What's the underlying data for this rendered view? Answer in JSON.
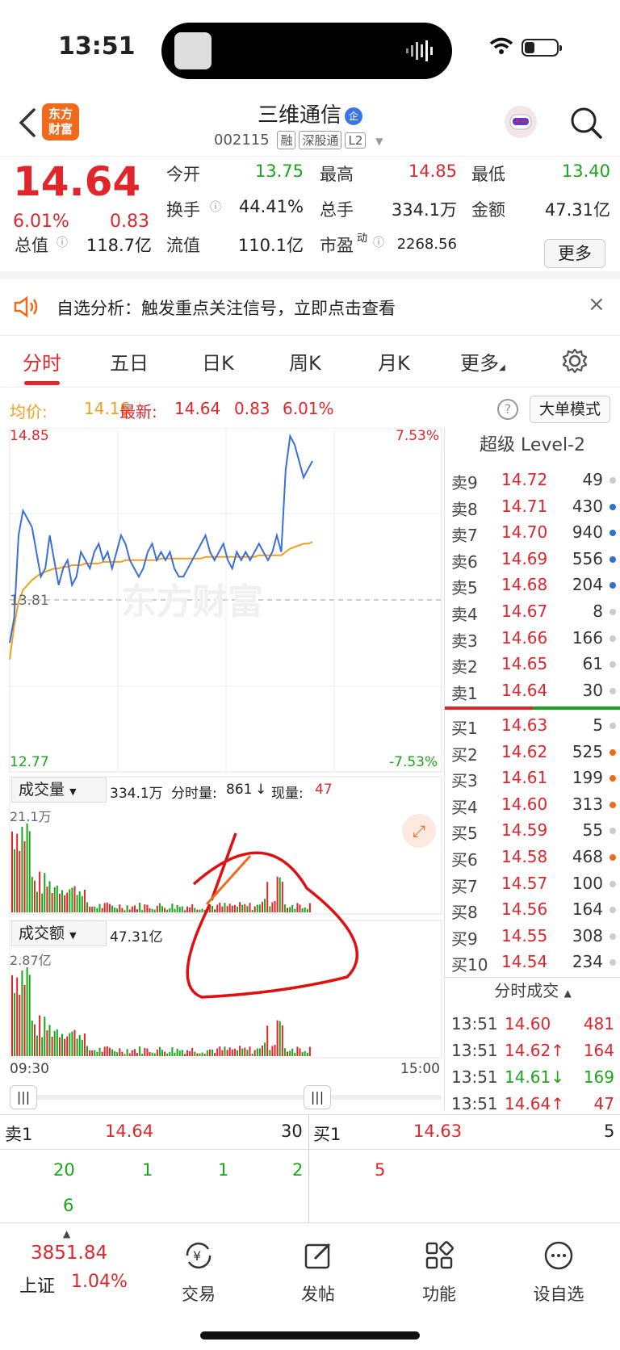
{
  "status": {
    "time": "13:51"
  },
  "header": {
    "logo_line1": "东方",
    "logo_line2": "财富",
    "name": "三维通信",
    "badge": "企",
    "code": "002115",
    "tags": [
      "融",
      "深股通",
      "L2"
    ]
  },
  "quote": {
    "price": "14.64",
    "pct": "6.01%",
    "change": "0.83",
    "open_label": "今开",
    "open": "13.75",
    "high_label": "最高",
    "high": "14.85",
    "low_label": "最低",
    "low": "13.40",
    "turnover_label": "换手",
    "turnover": "44.41%",
    "volume_label": "总手",
    "volume": "334.1万",
    "amount_label": "金额",
    "amount": "47.31亿",
    "mktcap_label": "总值",
    "mktcap": "118.7亿",
    "float_label": "流值",
    "float": "110.1亿",
    "pe_label": "市盈",
    "pe_sup": "动",
    "pe": "2268.56",
    "more": "更多"
  },
  "notice": {
    "text": "自选分析：触发重点关注信号，立即点击查看"
  },
  "tabs": [
    "分时",
    "五日",
    "日K",
    "周K",
    "月K",
    "更多"
  ],
  "avg": {
    "avg_label": "均价:",
    "avg": "14.16",
    "latest_label": "最新:",
    "latest": "14.64",
    "chg": "0.83",
    "pct": "6.01%",
    "mode": "大单模式"
  },
  "chart": {
    "price_top": "14.85",
    "price_mid": "13.81",
    "price_bot": "12.77",
    "pct_top": "7.53%",
    "pct_bot": "-7.53%",
    "vol_label": "成交量",
    "vol_total": "334.1万",
    "vol_min_label": "分时量:",
    "vol_min": "861",
    "vol_now_label": "现量:",
    "vol_now": "47",
    "vol_max": "21.1万",
    "amt_label": "成交额",
    "amt_total": "47.31亿",
    "amt_max": "2.87亿",
    "t_start": "09:30",
    "t_end": "15:00",
    "watermark": "东方财富"
  },
  "chart_data": {
    "type": "line",
    "x_range": [
      "09:30",
      "15:00"
    ],
    "ylim": [
      12.77,
      14.85
    ],
    "prev_close": 13.81,
    "series": [
      {
        "values": [
          13.55,
          13.7,
          14.2,
          14.35,
          14.3,
          14.25,
          14.1,
          13.95,
          14.0,
          14.2,
          14.05,
          13.9,
          14.0,
          14.05,
          13.9,
          13.95,
          14.1,
          14.05,
          14.0,
          14.1,
          14.15,
          14.05,
          14.1,
          14.0,
          14.1,
          14.2,
          14.15,
          14.05,
          14.0,
          13.95,
          14.0,
          14.1,
          14.15,
          14.05,
          14.1,
          14.05,
          14.1,
          14.0,
          13.95,
          13.95,
          14.0,
          14.05,
          14.1,
          14.15,
          14.2,
          14.1,
          14.05,
          14.1,
          14.15,
          14.05,
          14.0,
          14.1,
          14.05,
          14.1,
          14.05,
          14.1,
          14.15,
          14.1,
          14.05,
          14.1,
          14.2,
          14.1,
          14.6,
          14.8,
          14.75,
          14.65,
          14.55,
          14.6,
          14.65
        ]
      },
      {
        "values": [
          13.45,
          13.65,
          13.8,
          13.87,
          13.9,
          13.93,
          13.95,
          13.97,
          13.98,
          13.99,
          14.0,
          14.0,
          14.01,
          14.01,
          14.02,
          14.02,
          14.02,
          14.03,
          14.03,
          14.03,
          14.03,
          14.04,
          14.04,
          14.04,
          14.04,
          14.04,
          14.05,
          14.05,
          14.05,
          14.05,
          14.05,
          14.05,
          14.05,
          14.05,
          14.06,
          14.06,
          14.06,
          14.06,
          14.06,
          14.06,
          14.06,
          14.06,
          14.06,
          14.06,
          14.07,
          14.07,
          14.07,
          14.07,
          14.07,
          14.07,
          14.07,
          14.07,
          14.07,
          14.07,
          14.07,
          14.07,
          14.08,
          14.08,
          14.08,
          14.08,
          14.08,
          14.08,
          14.1,
          14.12,
          14.13,
          14.14,
          14.15,
          14.15,
          14.16
        ]
      }
    ]
  },
  "orderbook": {
    "title": "超级 Level-2",
    "asks": [
      {
        "l": "卖9",
        "p": "14.72",
        "v": "49",
        "dot": "#cccccc"
      },
      {
        "l": "卖8",
        "p": "14.71",
        "v": "430",
        "dot": "#2f6fd0"
      },
      {
        "l": "卖7",
        "p": "14.70",
        "v": "940",
        "dot": "#2f6fd0"
      },
      {
        "l": "卖6",
        "p": "14.69",
        "v": "556",
        "dot": "#2f6fd0"
      },
      {
        "l": "卖5",
        "p": "14.68",
        "v": "204",
        "dot": "#2f6fd0"
      },
      {
        "l": "卖4",
        "p": "14.67",
        "v": "8",
        "dot": "#cccccc"
      },
      {
        "l": "卖3",
        "p": "14.66",
        "v": "166",
        "dot": "#cccccc"
      },
      {
        "l": "卖2",
        "p": "14.65",
        "v": "61",
        "dot": "#cccccc"
      },
      {
        "l": "卖1",
        "p": "14.64",
        "v": "30",
        "dot": "#cccccc"
      }
    ],
    "bids": [
      {
        "l": "买1",
        "p": "14.63",
        "v": "5",
        "dot": "#cccccc"
      },
      {
        "l": "买2",
        "p": "14.62",
        "v": "525",
        "dot": "#f06a1e"
      },
      {
        "l": "买3",
        "p": "14.61",
        "v": "199",
        "dot": "#f06a1e"
      },
      {
        "l": "买4",
        "p": "14.60",
        "v": "313",
        "dot": "#f06a1e"
      },
      {
        "l": "买5",
        "p": "14.59",
        "v": "55",
        "dot": "#cccccc"
      },
      {
        "l": "买6",
        "p": "14.58",
        "v": "468",
        "dot": "#f06a1e"
      },
      {
        "l": "买7",
        "p": "14.57",
        "v": "100",
        "dot": "#cccccc"
      },
      {
        "l": "买8",
        "p": "14.56",
        "v": "164",
        "dot": "#cccccc"
      },
      {
        "l": "买9",
        "p": "14.55",
        "v": "308",
        "dot": "#cccccc"
      },
      {
        "l": "买10",
        "p": "14.54",
        "v": "234",
        "dot": "#cccccc"
      }
    ],
    "trades_title": "分时成交",
    "trades": [
      {
        "t": "13:51",
        "p": "14.60",
        "v": "481",
        "vc": "red"
      },
      {
        "t": "13:51",
        "p": "14.62↑",
        "v": "164",
        "vc": "red"
      },
      {
        "t": "13:51",
        "p": "14.61↓",
        "v": "169",
        "vc": "green"
      },
      {
        "t": "13:51",
        "p": "14.64↑",
        "v": "47",
        "vc": "red"
      }
    ]
  },
  "level1": {
    "sell_label": "卖1",
    "sell_price": "14.64",
    "sell_vol": "30",
    "buy_label": "买1",
    "buy_price": "14.63",
    "buy_vol": "5",
    "sell_orders": [
      "20",
      "1",
      "1",
      "2",
      "6"
    ],
    "buy_orders": [
      "5"
    ]
  },
  "bottom": {
    "index_value": "3851.84",
    "index_name": "上证",
    "index_pct": "1.04%",
    "nav": [
      "交易",
      "发帖",
      "功能",
      "设自选"
    ]
  }
}
